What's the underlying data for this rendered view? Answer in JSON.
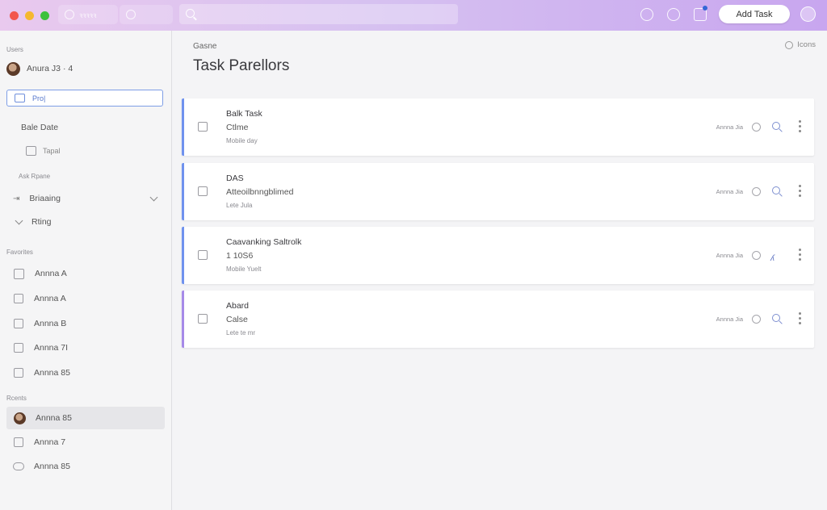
{
  "window": {
    "tabs": [
      {
        "label": "ꝛꝛꝛꝛꝛ",
        "icon": "flower-icon"
      },
      {
        "label": "",
        "icon": "flower-icon"
      }
    ],
    "search_placeholder": "",
    "add_button_label": "Add Task"
  },
  "sidebar": {
    "section_top": "Users",
    "user_name": "Anura J3 · 4",
    "input_value": "Pro|",
    "group_label": "Bale Date",
    "group_item": "Tapal",
    "section_ask": "Ask Rpane",
    "expand_rows": [
      "Briaaing",
      "Rting"
    ],
    "section_fav": "Favorites",
    "fav_items": [
      "Annna A",
      "Annna A",
      "Annna B",
      "Annna 7I",
      "Annna 85"
    ],
    "section_recent": "Rcents",
    "recent_items": [
      "Annna 85",
      "Annna 7",
      "Annna 85"
    ]
  },
  "main": {
    "breadcrumb": "Gasne",
    "title": "Task Parellors",
    "top_action": "Icons",
    "cards": [
      {
        "title": "Balk Task",
        "subtitle": "Ctlme",
        "note": "Mobile day",
        "meta": "Annna Jia",
        "accent": "#6f92ee"
      },
      {
        "title": "DAS",
        "subtitle": "Atteoilbnngblimed",
        "note": "Lete Jula",
        "meta": "Annna Jia",
        "accent": "#6f92ee"
      },
      {
        "title": "Caavanking Saltrolk",
        "subtitle": "1 10S6",
        "note": "Mobile Yuelt",
        "meta": "Annna Jia",
        "accent": "#6f92ee"
      },
      {
        "title": "Abard",
        "subtitle": "Calse",
        "note": "Lete te mr",
        "meta": "Annna Jia",
        "accent": "#a68ae8"
      }
    ]
  }
}
